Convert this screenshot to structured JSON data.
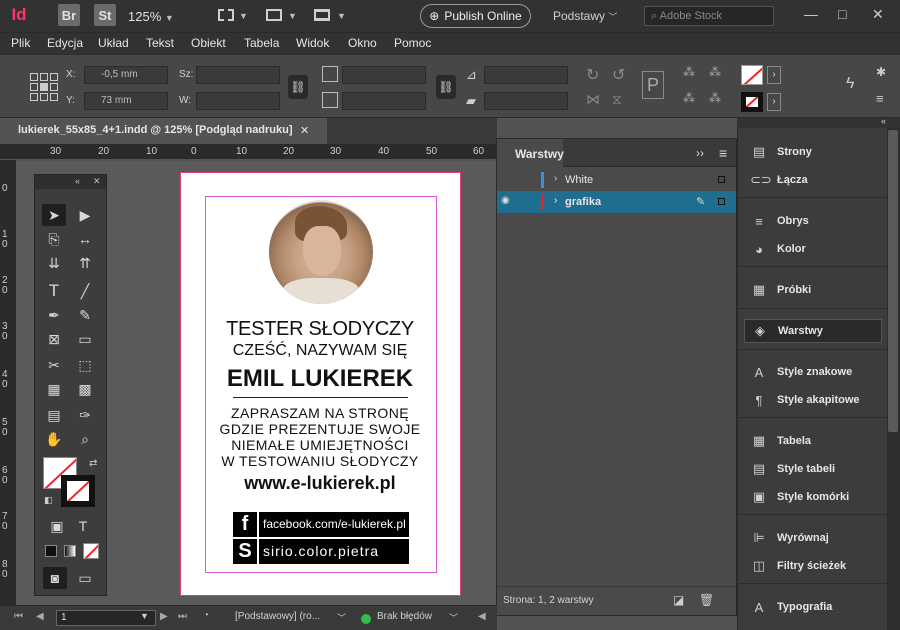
{
  "app": {
    "logo": "Id",
    "bridge": "Br",
    "stock": "St",
    "zoom": "125%",
    "publish": "Publish Online",
    "workspace": "Podstawy",
    "search_placeholder": "Adobe Stock",
    "window_controls": [
      "—",
      "□",
      "✕"
    ]
  },
  "menu": [
    "Plik",
    "Edycja",
    "Układ",
    "Tekst",
    "Obiekt",
    "Tabela",
    "Widok",
    "Okno",
    "Pomoc"
  ],
  "control": {
    "x_label": "X:",
    "x_value": "-0,5 mm",
    "y_label": "Y:",
    "y_value": "73 mm",
    "w_label": "Sz:",
    "h_label": "W:"
  },
  "document": {
    "tab_title": "lukierek_55x85_4+1.indd @ 125% [Podgląd nadruku]",
    "close": "✕"
  },
  "rulers": {
    "h_ticks": [
      "30",
      "20",
      "10",
      "0",
      "10",
      "20",
      "30",
      "40",
      "50",
      "60"
    ],
    "v_ticks": [
      "0",
      "1 0",
      "2 0",
      "3 0",
      "4 0",
      "5 0",
      "6 0",
      "7 0",
      "8 0"
    ]
  },
  "card": {
    "title": "TESTER SŁODYCZY",
    "greeting": "CZEŚĆ, NAZYWAM SIĘ",
    "name": "EMIL LUKIEREK",
    "lines": [
      "ZAPRASZAM NA STRONĘ",
      "GDZIE PREZENTUJE SWOJE",
      "NIEMAŁE UMIEJĘTNOŚCI",
      "W TESTOWANIU SŁODYCZY"
    ],
    "url": "www.e-lukierek.pl",
    "facebook_icon": "f",
    "facebook": "facebook.com/e-lukierek.pl",
    "skype_icon": "S",
    "skype": "sirio.color.pietra"
  },
  "layers": {
    "tab": "Warstwy",
    "menu_icon": "≡",
    "collapse": "››",
    "rows": [
      {
        "name": "White",
        "color": "#3a8fe0",
        "visible": false
      },
      {
        "name": "grafika",
        "color": "#e8202a",
        "visible": true
      }
    ],
    "footer": "Strona: 1, 2 warstwy"
  },
  "dock": {
    "items": [
      {
        "label": "Strony",
        "icon": "▤"
      },
      {
        "label": "Łącza",
        "icon": "⊂⊃"
      },
      {
        "label": "Obrys",
        "icon": "≡"
      },
      {
        "label": "Kolor",
        "icon": "◕"
      },
      {
        "label": "Próbki",
        "icon": "▦"
      },
      {
        "label": "Warstwy",
        "icon": "◈"
      },
      {
        "label": "Style znakowe",
        "icon": "A"
      },
      {
        "label": "Style akapitowe",
        "icon": "¶"
      },
      {
        "label": "Tabela",
        "icon": "▦"
      },
      {
        "label": "Style tabeli",
        "icon": "▤"
      },
      {
        "label": "Style komórki",
        "icon": "▣"
      },
      {
        "label": "Wyrównaj",
        "icon": "⊫"
      },
      {
        "label": "Filtry ścieżek",
        "icon": "◫"
      },
      {
        "label": "Typografia",
        "icon": "A"
      }
    ]
  },
  "status": {
    "page": "1",
    "style": "[Podstawowy] (ro...",
    "errors": "Brak błędów"
  },
  "colors": {
    "accent": "#1f6e8f",
    "page_border": "#e0406b",
    "margin": "#d25ad2",
    "ok": "#2fbf4a"
  }
}
